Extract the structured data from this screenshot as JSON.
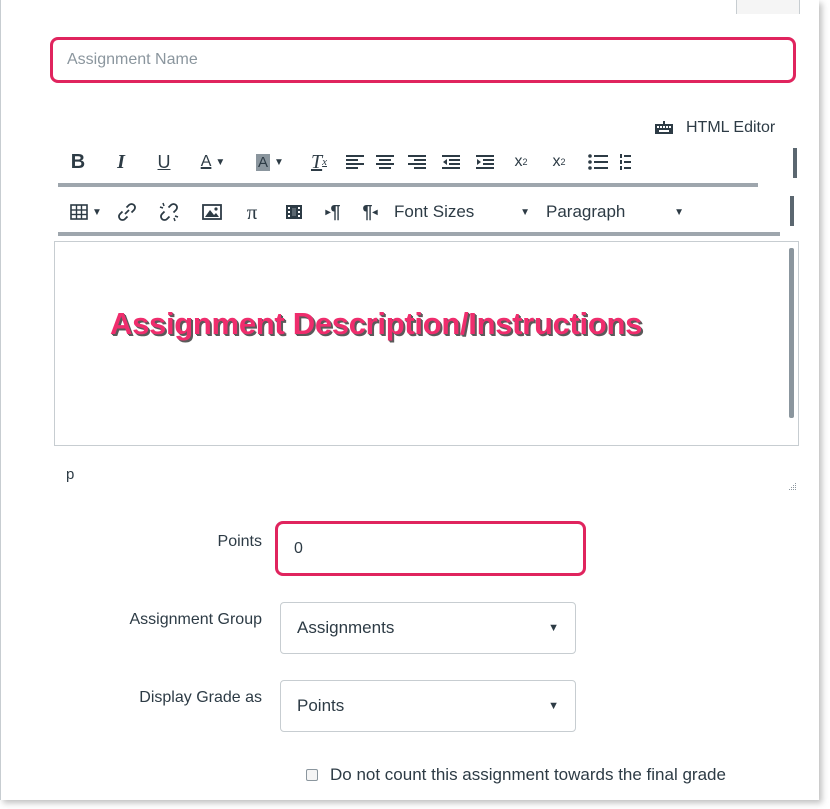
{
  "assignment_name": {
    "placeholder": "Assignment Name",
    "value": ""
  },
  "editor": {
    "html_editor_label": "HTML Editor",
    "font_sizes_label": "Font Sizes",
    "paragraph_label": "Paragraph",
    "path": "p",
    "overlay_text": "Assignment Description/Instructions"
  },
  "points": {
    "label": "Points",
    "value": "0"
  },
  "assignment_group": {
    "label": "Assignment Group",
    "selected": "Assignments"
  },
  "display_grade": {
    "label": "Display Grade as",
    "selected": "Points"
  },
  "exclude_final_grade": {
    "label": "Do not count this assignment towards the final grade",
    "checked": false
  },
  "colors": {
    "highlight": "#e0245e",
    "overlay_text": "#ef2d6d",
    "text": "#2d3b45",
    "border": "#c7cdd1"
  },
  "icons": [
    "keyboard-icon",
    "bold-icon",
    "italic-icon",
    "underline-icon",
    "text-color-icon",
    "background-color-icon",
    "clear-formatting-icon",
    "align-left-icon",
    "align-center-icon",
    "align-right-icon",
    "outdent-icon",
    "indent-icon",
    "superscript-icon",
    "subscript-icon",
    "bullet-list-icon",
    "numbered-list-icon",
    "table-icon",
    "link-icon",
    "unlink-icon",
    "image-icon",
    "equation-icon",
    "media-icon",
    "ltr-icon",
    "rtl-icon"
  ]
}
